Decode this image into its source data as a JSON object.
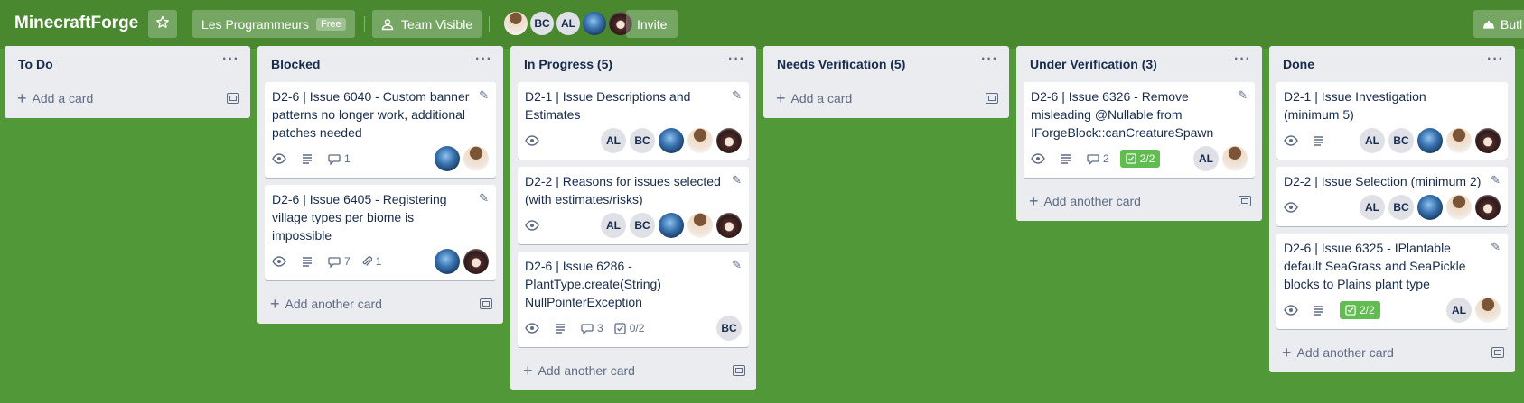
{
  "header": {
    "board_title": "MinecraftForge",
    "workspace_name": "Les Programmeurs",
    "workspace_badge": "Free",
    "visibility_label": "Team Visible",
    "member_initials": [
      "BC",
      "AL"
    ],
    "invite_label": "Invite",
    "butler_label": "Butl"
  },
  "lists": [
    {
      "title": "To Do",
      "cards": [],
      "add_label": "Add a card"
    },
    {
      "title": "Blocked",
      "cards": [
        {
          "title": "D2-6 | Issue 6040 - Custom banner patterns no longer work, additional patches needed",
          "comments": "1"
        },
        {
          "title": "D2-6 | Issue 6405 - Registering village types per biome is impossible",
          "comments": "7",
          "attachments": "1"
        }
      ],
      "add_label": "Add another card"
    },
    {
      "title": "In Progress (5)",
      "cards": [
        {
          "title": "D2-1 | Issue Descriptions and Estimates",
          "members": [
            "AL",
            "BC"
          ]
        },
        {
          "title": "D2-2 | Reasons for issues selected (with estimates/risks)",
          "members": [
            "AL",
            "BC"
          ]
        },
        {
          "title": "D2-6 | Issue 6286 - PlantType.create(String) NullPointerException",
          "comments": "3",
          "checklist": "0/2",
          "members": [
            "BC"
          ]
        }
      ],
      "add_label": "Add another card"
    },
    {
      "title": "Needs Verification (5)",
      "cards": [],
      "add_label": "Add a card"
    },
    {
      "title": "Under Verification (3)",
      "cards": [
        {
          "title": "D2-6 | Issue 6326 - Remove misleading @Nullable from IForgeBlock::canCreatureSpawn",
          "comments": "2",
          "checklist": "2/2",
          "members": [
            "AL"
          ]
        }
      ],
      "add_label": "Add another card"
    },
    {
      "title": "Done",
      "cards": [
        {
          "title": "D2-1 | Issue Investigation (minimum 5)",
          "members": [
            "AL",
            "BC"
          ]
        },
        {
          "title": "D2-2 | Issue Selection (minimum 2)",
          "members": [
            "AL",
            "BC"
          ]
        },
        {
          "title": "D2-6 | Issue 6325 - IPlantable default SeaGrass and SeaPickle blocks to Plains plant type",
          "checklist": "2/2",
          "members": [
            "AL"
          ]
        }
      ],
      "add_label": "Add another card"
    }
  ],
  "colors": {
    "board_bg": "#519839",
    "topbar_bg": "#49882f",
    "checklist_complete": "#61bd4f"
  }
}
